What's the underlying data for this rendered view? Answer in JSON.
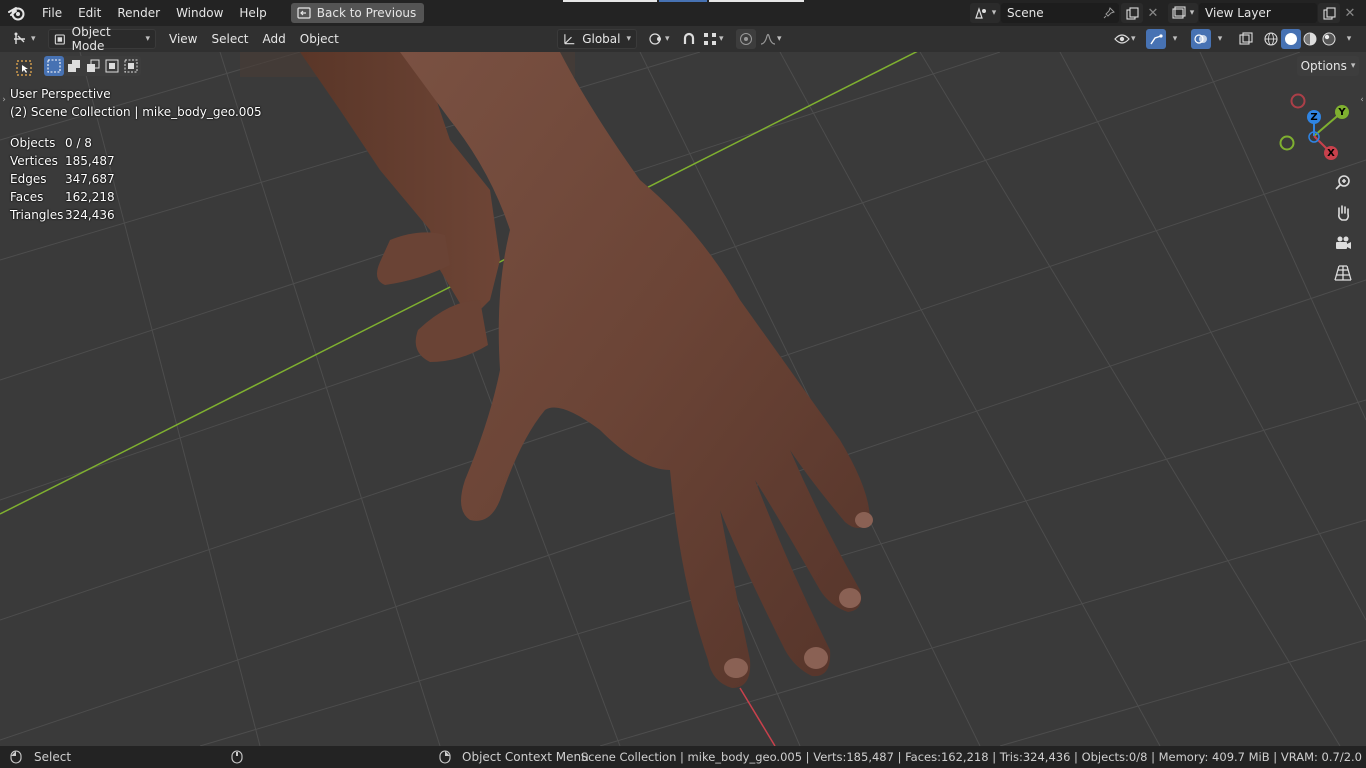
{
  "app": {
    "menus": [
      "File",
      "Edit",
      "Render",
      "Window",
      "Help"
    ],
    "back_button": "Back to Previous"
  },
  "scene": {
    "name": "Scene",
    "view_layer": "View Layer"
  },
  "header": {
    "mode": "Object Mode",
    "menus": [
      "View",
      "Select",
      "Add",
      "Object"
    ],
    "orientation": "Global",
    "options_label": "Options"
  },
  "viewport": {
    "perspective": "User Perspective",
    "collection": "(2) Scene Collection | mike_body_geo.005",
    "stats": [
      {
        "label": "Objects",
        "value": "0 / 8"
      },
      {
        "label": "Vertices",
        "value": "185,487"
      },
      {
        "label": "Edges",
        "value": "347,687"
      },
      {
        "label": "Faces",
        "value": "162,218"
      },
      {
        "label": "Triangles",
        "value": "324,436"
      }
    ],
    "gizmo": {
      "x": "X",
      "y": "Y",
      "z": "Z"
    }
  },
  "statusbar": {
    "left_action": "Select",
    "middle_action": "Object Context Menu",
    "info": "Scene Collection | mike_body_geo.005 | Verts:185,487 | Faces:162,218 | Tris:324,436 | Objects:0/8 | Memory: 409.7 MiB | VRAM: 0.7/2.0"
  },
  "colors": {
    "topbar": "#232323",
    "viewport": "#3a3a3a",
    "grid_line": "#4a4a4a",
    "x_axis": "#c8414c",
    "y_axis": "#7fb030",
    "z_axis": "#2f84e3",
    "skin": "#6a4335",
    "accent": "#4772b3"
  },
  "icons": [
    "blender-logo-icon",
    "back-icon",
    "scene-icon",
    "view-layer-icon",
    "editor-type-icon",
    "object-mode-icon",
    "transform-orientation-icon",
    "pivot-icon",
    "snap-icon",
    "proportional-icon",
    "visibility-icon",
    "gizmo-icon",
    "overlay-icon",
    "xray-icon",
    "wireframe-shading-icon",
    "solid-shading-icon",
    "material-shading-icon",
    "rendered-shading-icon",
    "zoom-icon",
    "pan-hand-icon",
    "camera-icon",
    "grid-view-icon",
    "mouse-icon"
  ]
}
